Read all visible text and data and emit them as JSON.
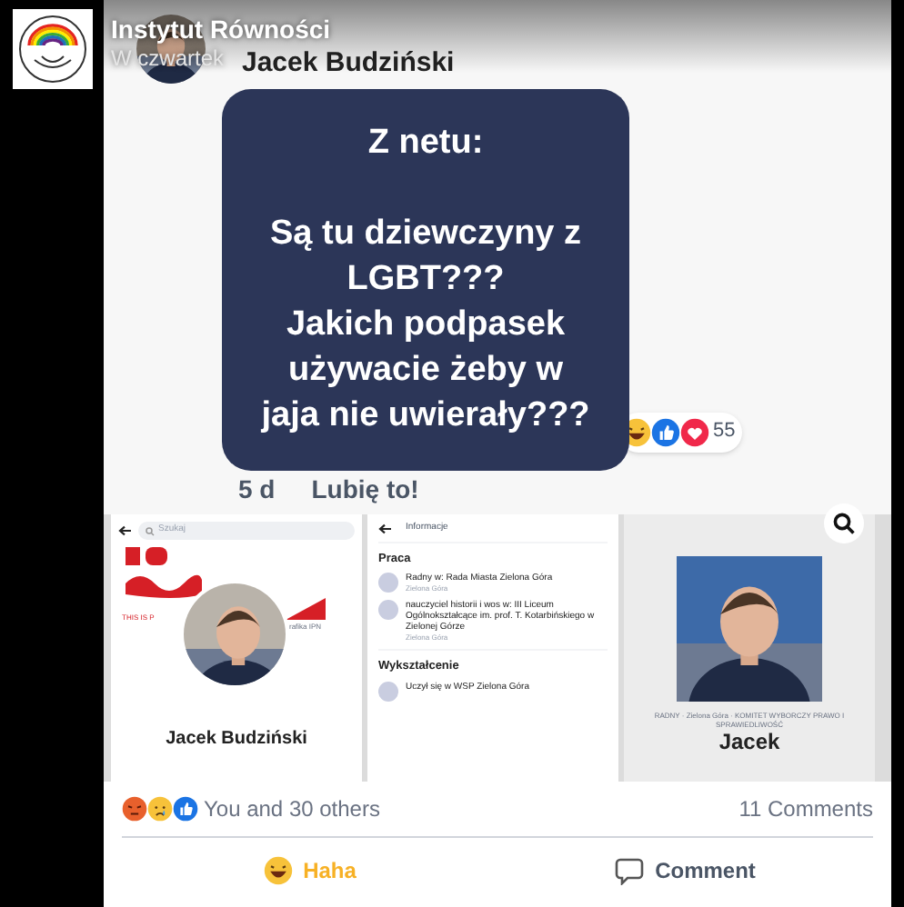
{
  "header": {
    "title": "Instytut Równości",
    "time": "W czwartek"
  },
  "comment": {
    "author": "Jacek Budziński",
    "heading": "Z netu:",
    "body_lines": [
      "Są tu dziewczyny z",
      "LGBT???",
      "Jakich podpasek",
      "używacie żeby w",
      "jaja nie uwierały???"
    ],
    "reaction_count": "55",
    "age": "5 d",
    "like": "Lubię to!"
  },
  "profile_panel": {
    "search_placeholder": "Szukaj",
    "tagline": "THIS IS P",
    "credit": "rafika IPN",
    "name": "Jacek Budziński"
  },
  "info_panel": {
    "title": "Informacje",
    "sections": [
      {
        "heading": "Praca",
        "items": [
          {
            "title": "Radny w: Rada Miasta Zielona Góra",
            "subtitle": "Zielona Góra"
          },
          {
            "title": "nauczyciel historii i wos w: III Liceum Ogólnokształcące im. prof. T. Kotarbińskiego w Zielonej Górze",
            "subtitle": "Zielona Góra"
          }
        ]
      },
      {
        "heading": "Wykształcenie",
        "items": [
          {
            "title": "Uczył się w WSP Zielona Góra"
          }
        ]
      }
    ]
  },
  "poster_panel": {
    "caption": "RADNY · Zielona Góra · KOMITET WYBORCZY PRAWO I SPRAWIEDLIWOŚĆ",
    "name": "Jacek"
  },
  "footer": {
    "reactions_text": "You and 30 others",
    "comments": "11 Comments",
    "actions": [
      {
        "label": "Haha",
        "kind": "haha",
        "selected": true
      },
      {
        "label": "Comment",
        "kind": "comment",
        "selected": false
      }
    ]
  }
}
